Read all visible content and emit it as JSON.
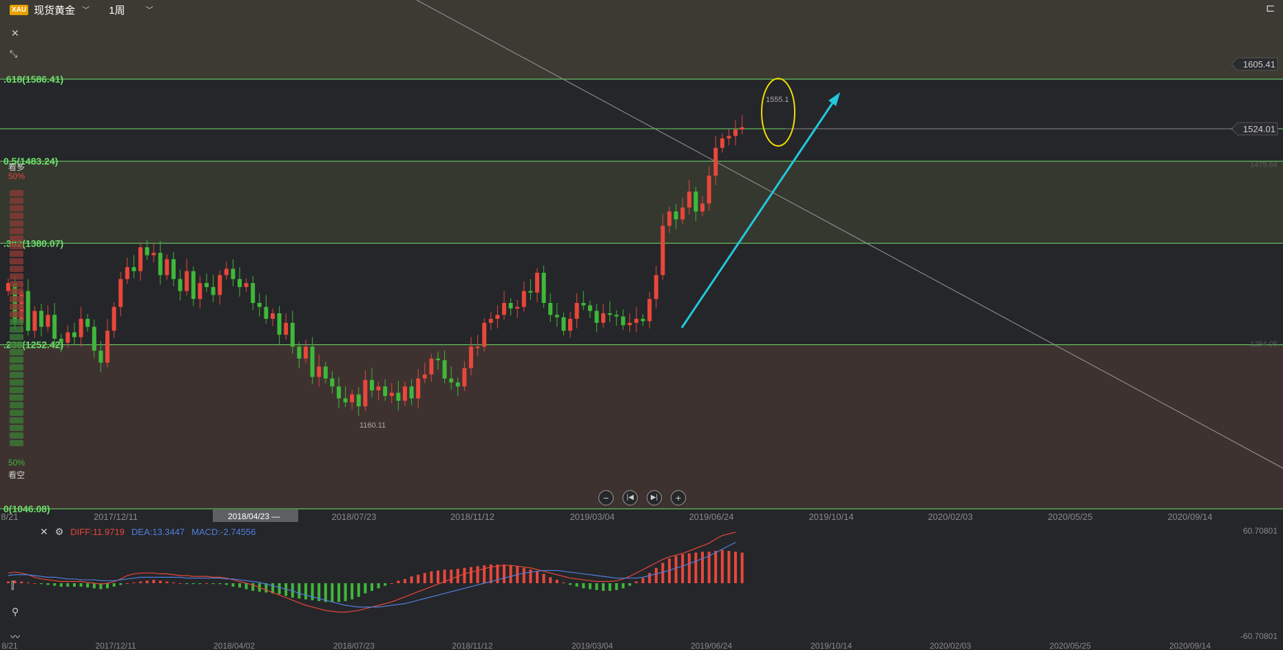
{
  "header": {
    "badge": "XAU",
    "symbol": "现货黄金",
    "period": "1周"
  },
  "sentiment": {
    "bull_label": "看多",
    "bull_pct": "50%",
    "bear_pct": "50%",
    "bear_label": "看空"
  },
  "colors": {
    "background": "#252629",
    "up": "#e8473b",
    "down": "#3fb83a",
    "fib_line": "#6ee06a",
    "trend_arrow": "#22c8dc",
    "highlight_ellipse": "#f0e000",
    "diff_line": "#e8473b",
    "dea_line": "#4f7fe0"
  },
  "macd_legend": {
    "diff": "DIFF:11.9719",
    "dea": "DEA:13.3447",
    "macd": "MACD:-2.74556"
  },
  "icons": [
    "close-icon",
    "shrink-icon",
    "settings-icon",
    "zoom-out-icon",
    "jump-start-icon",
    "jump-end-icon",
    "zoom-in-icon",
    "chart-tool-icon",
    "draw-tool-icon",
    "indicator-icon",
    "panel-icon"
  ],
  "chart_data": {
    "type": "candlestick",
    "ylim": [
      1046.08,
      1605.41
    ],
    "fib_levels": [
      {
        "ratio": ".618",
        "price": 1586.41,
        "label": ".618(1586.41)"
      },
      {
        "ratio": "",
        "price": 1524.01,
        "label": ""
      },
      {
        "ratio": "0.5",
        "price": 1483.24,
        "label": "0.5(1483.24)"
      },
      {
        "ratio": ".382",
        "price": 1380.07,
        "label": ".382(1380.07)"
      },
      {
        "ratio": ".236",
        "price": 1252.42,
        "label": ".236(1252.42)"
      },
      {
        "ratio": "0",
        "price": 1046.08,
        "label": "0(1046.08)"
      }
    ],
    "price_tags": [
      {
        "label": "1605.41",
        "price": 1605.41,
        "boxed": true
      },
      {
        "label": "1524.01",
        "price": 1524.01,
        "boxed": true
      },
      {
        "label": "1479.64",
        "price": 1479.64,
        "boxed": false
      },
      {
        "label": "1254.05",
        "price": 1254.05,
        "boxed": false
      }
    ],
    "x_ticks": [
      "8/21",
      "2017/12/11",
      "2018/04/23",
      "2018/07/23",
      "2018/11/12",
      "2019/03/04",
      "2019/06/24",
      "2019/10/14",
      "2020/02/03",
      "2020/05/25",
      "2020/09/14"
    ],
    "x_ticks_macd": [
      "8/21",
      "2017/12/11",
      "2018/04/02",
      "2018/07/23",
      "2018/11/12",
      "2019/03/04",
      "2019/06/24",
      "2019/10/14",
      "2020/02/03",
      "2020/05/25",
      "2020/09/14"
    ],
    "crosshair_label": "2018/04/23 —",
    "annotations": {
      "high": "1555.1",
      "low": "1160.11"
    },
    "macd_axis": {
      "max": "60.70801",
      "min": "-60.70801",
      "ylim": [
        -60.70801,
        60.70801
      ]
    },
    "closes": [
      1330,
      1280,
      1320,
      1270,
      1295,
      1275,
      1290,
      1260,
      1255,
      1268,
      1262,
      1285,
      1275,
      1245,
      1230,
      1270,
      1300,
      1335,
      1350,
      1345,
      1375,
      1365,
      1368,
      1340,
      1360,
      1335,
      1320,
      1345,
      1310,
      1330,
      1325,
      1315,
      1340,
      1348,
      1335,
      1325,
      1330,
      1305,
      1300,
      1285,
      1292,
      1265,
      1280,
      1250,
      1235,
      1250,
      1212,
      1225,
      1210,
      1200,
      1185,
      1180,
      1190,
      1175,
      1208,
      1195,
      1200,
      1188,
      1192,
      1182,
      1200,
      1185,
      1210,
      1215,
      1235,
      1233,
      1210,
      1205,
      1200,
      1223,
      1250,
      1250,
      1280,
      1285,
      1290,
      1305,
      1298,
      1300,
      1320,
      1318,
      1343,
      1305,
      1290,
      1287,
      1270,
      1285,
      1305,
      1302,
      1295,
      1280,
      1292,
      1290,
      1288,
      1277,
      1280,
      1285,
      1282,
      1310,
      1340,
      1402,
      1420,
      1410,
      1425,
      1445,
      1420,
      1430,
      1465,
      1500,
      1512,
      1515,
      1523,
      1526
    ],
    "macd_hist": [
      2,
      3,
      2,
      1,
      0,
      -1,
      -2,
      -3,
      -4,
      -4,
      -4,
      -4,
      -5,
      -6,
      -7,
      -6,
      -4,
      -2,
      0,
      1,
      2,
      3,
      4,
      3,
      2,
      1,
      0,
      -1,
      -1,
      -1,
      0,
      -1,
      -1,
      -2,
      -4,
      -5,
      -7,
      -9,
      -10,
      -11,
      -12,
      -13,
      -15,
      -17,
      -18,
      -19,
      -20,
      -21,
      -22,
      -22,
      -22,
      -21,
      -19,
      -16,
      -12,
      -9,
      -6,
      -3,
      0,
      3,
      5,
      8,
      10,
      12,
      14,
      15,
      16,
      16,
      17,
      18,
      19,
      20,
      21,
      22,
      22,
      22,
      21,
      20,
      18,
      16,
      14,
      11,
      7,
      4,
      1,
      -2,
      -4,
      -6,
      -7,
      -8,
      -9,
      -9,
      -8,
      -6,
      -3,
      2,
      6,
      12,
      18,
      24,
      29,
      32,
      34,
      35,
      36,
      37,
      37,
      38,
      39,
      38,
      37,
      36
    ],
    "diff_line": [
      12,
      13,
      12,
      10,
      7,
      5,
      4,
      3,
      2,
      2,
      2,
      2,
      1,
      0,
      -1,
      0,
      2,
      5,
      9,
      11,
      12,
      12,
      12,
      11,
      11,
      10,
      9,
      9,
      8,
      8,
      8,
      7,
      7,
      6,
      4,
      2,
      0,
      -2,
      -5,
      -8,
      -11,
      -14,
      -17,
      -20,
      -23,
      -26,
      -28,
      -30,
      -32,
      -33,
      -34,
      -34,
      -33,
      -32,
      -30,
      -28,
      -26,
      -24,
      -22,
      -19,
      -16,
      -13,
      -10,
      -7,
      -4,
      -1,
      2,
      5,
      8,
      11,
      13,
      15,
      17,
      19,
      20,
      21,
      21,
      20,
      19,
      18,
      16,
      14,
      12,
      10,
      8,
      6,
      5,
      4,
      3,
      2,
      2,
      2,
      3,
      5,
      8,
      12,
      16,
      20,
      24,
      28,
      31,
      33,
      35,
      38,
      41,
      44,
      47,
      52,
      56,
      58,
      60
    ],
    "dea_line": [
      9,
      10,
      10,
      10,
      9,
      8,
      7,
      7,
      6,
      5,
      5,
      4,
      4,
      4,
      3,
      3,
      3,
      4,
      5,
      6,
      7,
      7,
      7,
      7,
      7,
      7,
      7,
      6,
      6,
      6,
      6,
      6,
      6,
      5,
      5,
      4,
      3,
      2,
      1,
      -1,
      -3,
      -5,
      -7,
      -9,
      -12,
      -14,
      -16,
      -18,
      -20,
      -22,
      -24,
      -26,
      -27,
      -28,
      -28,
      -28,
      -28,
      -27,
      -26,
      -25,
      -24,
      -22,
      -20,
      -18,
      -16,
      -14,
      -12,
      -10,
      -8,
      -6,
      -4,
      -2,
      0,
      2,
      4,
      6,
      8,
      10,
      12,
      13,
      14,
      15,
      15,
      15,
      14,
      13,
      12,
      11,
      10,
      9,
      8,
      7,
      6,
      6,
      6,
      6,
      7,
      9,
      11,
      13,
      15,
      18,
      20,
      23,
      26,
      29,
      32,
      36,
      40,
      44,
      48
    ]
  }
}
